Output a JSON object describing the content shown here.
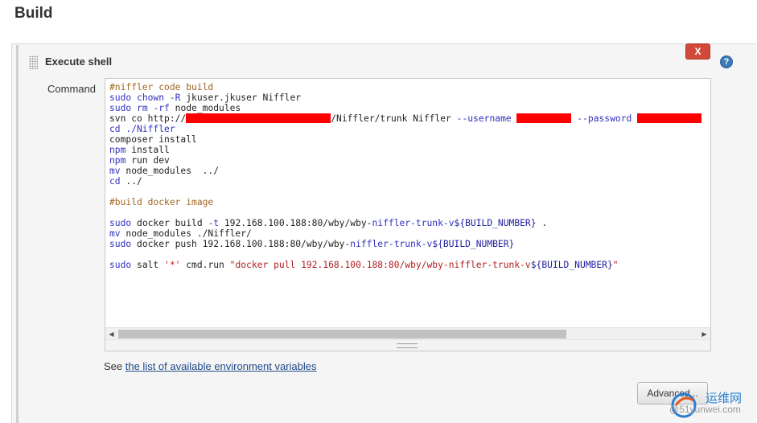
{
  "page": {
    "title": "Build"
  },
  "build_step": {
    "title": "Execute shell",
    "delete_label": "X",
    "help_label": "?",
    "command_label": "Command"
  },
  "command_lines": [
    [
      {
        "t": "#niffler code build",
        "c": "comment"
      }
    ],
    [
      {
        "t": "sudo ",
        "c": "keyword"
      },
      {
        "t": "chown",
        "c": "keyword"
      },
      {
        "t": " ",
        "c": ""
      },
      {
        "t": "-R",
        "c": "keyword"
      },
      {
        "t": " jkuser.jkuser Niffler",
        "c": ""
      }
    ],
    [
      {
        "t": "sudo ",
        "c": "keyword"
      },
      {
        "t": "rm",
        "c": "keyword"
      },
      {
        "t": " ",
        "c": ""
      },
      {
        "t": "-rf",
        "c": "keyword"
      },
      {
        "t": " node_modules",
        "c": ""
      }
    ],
    [
      {
        "t": "svn co http://",
        "c": ""
      },
      {
        "r": 180
      },
      {
        "t": "/Niffler/trunk Niffler ",
        "c": ""
      },
      {
        "t": "--username",
        "c": "keyword"
      },
      {
        "t": " ",
        "c": ""
      },
      {
        "r": 68
      },
      {
        "t": " ",
        "c": ""
      },
      {
        "t": "--password",
        "c": "keyword"
      },
      {
        "t": " ",
        "c": ""
      },
      {
        "r": 80
      }
    ],
    [
      {
        "t": "cd ./Niffler",
        "c": "keyword"
      }
    ],
    [
      {
        "t": "composer install",
        "c": ""
      }
    ],
    [
      {
        "t": "npm",
        "c": "keyword"
      },
      {
        "t": " install",
        "c": ""
      }
    ],
    [
      {
        "t": "npm",
        "c": "keyword"
      },
      {
        "t": " run dev",
        "c": ""
      }
    ],
    [
      {
        "t": "mv",
        "c": "keyword"
      },
      {
        "t": " node_modules  ../",
        "c": ""
      }
    ],
    [
      {
        "t": "cd",
        "c": "keyword"
      },
      {
        "t": " ../",
        "c": ""
      }
    ],
    [],
    [
      {
        "t": "#build docker image",
        "c": "comment"
      }
    ],
    [],
    [
      {
        "t": "sudo",
        "c": "keyword"
      },
      {
        "t": " docker build ",
        "c": ""
      },
      {
        "t": "-t",
        "c": "keyword"
      },
      {
        "t": " 192.168.100.188:80/wby/wby-",
        "c": ""
      },
      {
        "t": "niffler-trunk-v",
        "c": "keyword"
      },
      {
        "t": "${BUILD_NUMBER}",
        "c": "var"
      },
      {
        "t": " .",
        "c": ""
      }
    ],
    [
      {
        "t": "mv",
        "c": "keyword"
      },
      {
        "t": " node_modules ./Niffler/",
        "c": ""
      }
    ],
    [
      {
        "t": "sudo",
        "c": "keyword"
      },
      {
        "t": " docker push 192.168.100.188:80/wby/wby-",
        "c": ""
      },
      {
        "t": "niffler-trunk-v",
        "c": "keyword"
      },
      {
        "t": "${BUILD_NUMBER}",
        "c": "var"
      }
    ],
    [],
    [
      {
        "t": "sudo",
        "c": "keyword"
      },
      {
        "t": " salt ",
        "c": ""
      },
      {
        "t": "'*'",
        "c": "string"
      },
      {
        "t": " cmd.run ",
        "c": ""
      },
      {
        "t": "\"docker pull 192.168.100.188:80/wby/wby-niffler-trunk-v",
        "c": "string"
      },
      {
        "t": "${BUILD_NUMBER}",
        "c": "var"
      },
      {
        "t": "\"",
        "c": "string"
      }
    ]
  ],
  "scrollbar": {
    "left_arrow": "◀",
    "right_arrow": "▶"
  },
  "env_vars": {
    "prefix": "See ",
    "link": "the list of available environment variables"
  },
  "advanced_button_label": "Advanced...",
  "watermark": {
    "name": "运维网",
    "sub": "@51yunwei.com"
  }
}
